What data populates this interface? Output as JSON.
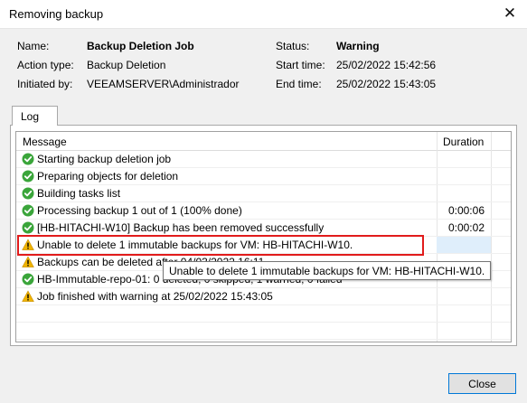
{
  "window": {
    "title": "Removing backup"
  },
  "summary": {
    "name_label": "Name:",
    "name_value": "Backup Deletion Job",
    "action_label": "Action type:",
    "action_value": "Backup Deletion",
    "initiated_label": "Initiated by:",
    "initiated_value": "VEEAMSERVER\\Administrador",
    "status_label": "Status:",
    "status_value": "Warning",
    "start_label": "Start time:",
    "start_value": "25/02/2022 15:42:56",
    "end_label": "End time:",
    "end_value": "25/02/2022 15:43:05"
  },
  "tabs": [
    {
      "label": "Log"
    }
  ],
  "log": {
    "columns": {
      "message": "Message",
      "duration": "Duration"
    },
    "rows": [
      {
        "status": "success",
        "message": "Starting backup deletion job",
        "duration": ""
      },
      {
        "status": "success",
        "message": "Preparing objects for deletion",
        "duration": ""
      },
      {
        "status": "success",
        "message": "Building tasks list",
        "duration": ""
      },
      {
        "status": "success",
        "message": "Processing backup 1 out of 1 (100% done)",
        "duration": "0:00:06"
      },
      {
        "status": "success",
        "message": "[HB-HITACHI-W10] Backup has been removed successfully",
        "duration": "0:00:02"
      },
      {
        "status": "warning",
        "message": "Unable to delete 1 immutable backups for VM: HB-HITACHI-W10.",
        "duration": ""
      },
      {
        "status": "warning",
        "message": "Backups can be deleted after 04/03/2022 16:11",
        "duration": ""
      },
      {
        "status": "success",
        "message": "HB-Immutable-repo-01: 0 deleted, 0 skipped, 1 warned, 0 failed",
        "duration": ""
      },
      {
        "status": "warning",
        "message": "Job finished with warning at 25/02/2022 15:43:05",
        "duration": ""
      },
      {
        "status": "",
        "message": "",
        "duration": ""
      },
      {
        "status": "",
        "message": "",
        "duration": ""
      }
    ]
  },
  "tooltip": {
    "text": "Unable to delete 1 immutable backups for VM: HB-HITACHI-W10."
  },
  "buttons": {
    "close": "Close"
  },
  "icons": {
    "success": "check-circle-icon",
    "warning": "warning-triangle-icon",
    "window_close": "close-icon"
  },
  "colors": {
    "success": "#3aa53a",
    "warning": "#f0b400",
    "highlight": "#e11b1b"
  }
}
